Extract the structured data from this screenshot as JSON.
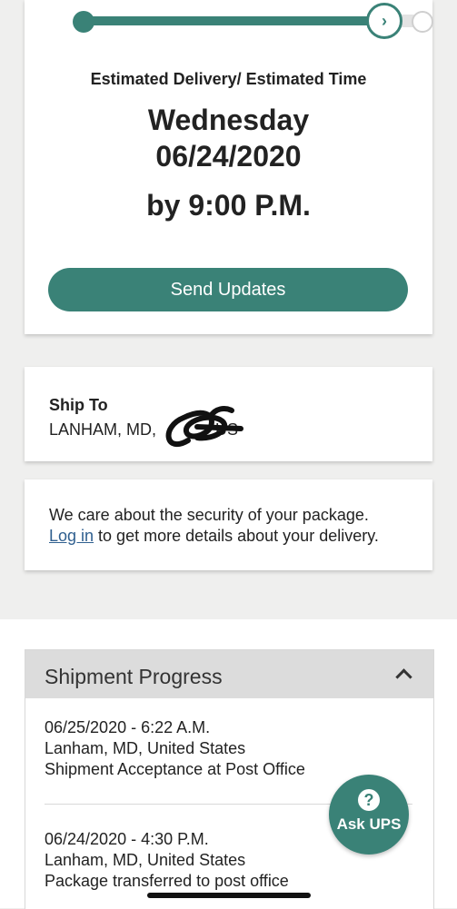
{
  "delivery": {
    "estimate_label": "Estimated Delivery/ Estimated Time",
    "day": "Wednesday",
    "date": "06/24/2020",
    "time": "by 9:00 P.M.",
    "send_updates_label": "Send Updates",
    "accent_color": "#3a8277"
  },
  "ship_to": {
    "title": "Ship To",
    "address_prefix": "LANHAM, MD,",
    "address_suffix": "US"
  },
  "security": {
    "text_line1": "We care about the security of your package.",
    "login_link": "Log in",
    "text_line2_rest": " to get more details about your delivery."
  },
  "progress": {
    "title": "Shipment Progress",
    "events": [
      {
        "datetime": "06/25/2020 - 6:22 A.M.",
        "location": "Lanham, MD, United States",
        "activity": "Shipment Acceptance at Post Office"
      },
      {
        "datetime": "06/24/2020 - 4:30 P.M.",
        "location": "Lanham, MD, United States",
        "activity": "Package transferred to post office"
      }
    ]
  },
  "ask": {
    "icon_glyph": "?",
    "label": "Ask UPS"
  },
  "icons": {
    "current_step": "chevron-right-icon",
    "collapse": "chevron-up-icon",
    "help": "question-icon"
  }
}
